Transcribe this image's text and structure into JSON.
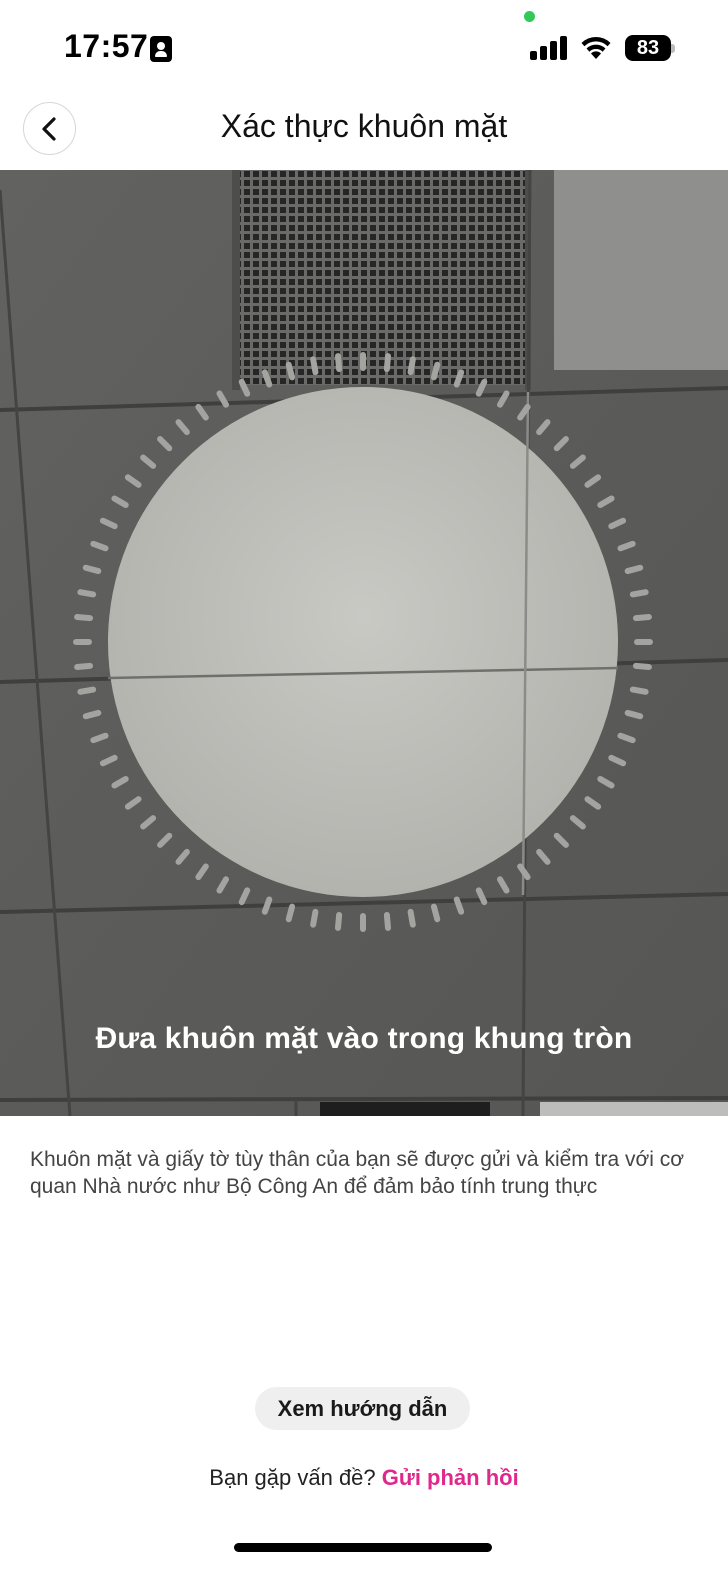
{
  "status_bar": {
    "time": "17:57",
    "battery_level": "83",
    "icons": [
      "contact-card-icon",
      "signal-icon",
      "wifi-icon",
      "battery-icon"
    ]
  },
  "header": {
    "title": "Xác thực khuôn mặt",
    "back_icon": "chevron-left-icon"
  },
  "camera": {
    "instruction": "Đưa khuôn mặt vào trong khung tròn",
    "progress_ring_ticks": 72
  },
  "description": "Khuôn mặt và giấy tờ tùy thân của bạn sẽ được gửi và kiểm tra với cơ quan Nhà nước như Bộ Công An để đảm bảo tính trung thực",
  "guide_button": {
    "label": "Xem hướng dẫn"
  },
  "feedback": {
    "prompt": "Bạn gặp vấn đề?",
    "link_label": "Gửi phản hồi"
  },
  "colors": {
    "accent": "#e0278c",
    "status_green": "#34c759"
  }
}
